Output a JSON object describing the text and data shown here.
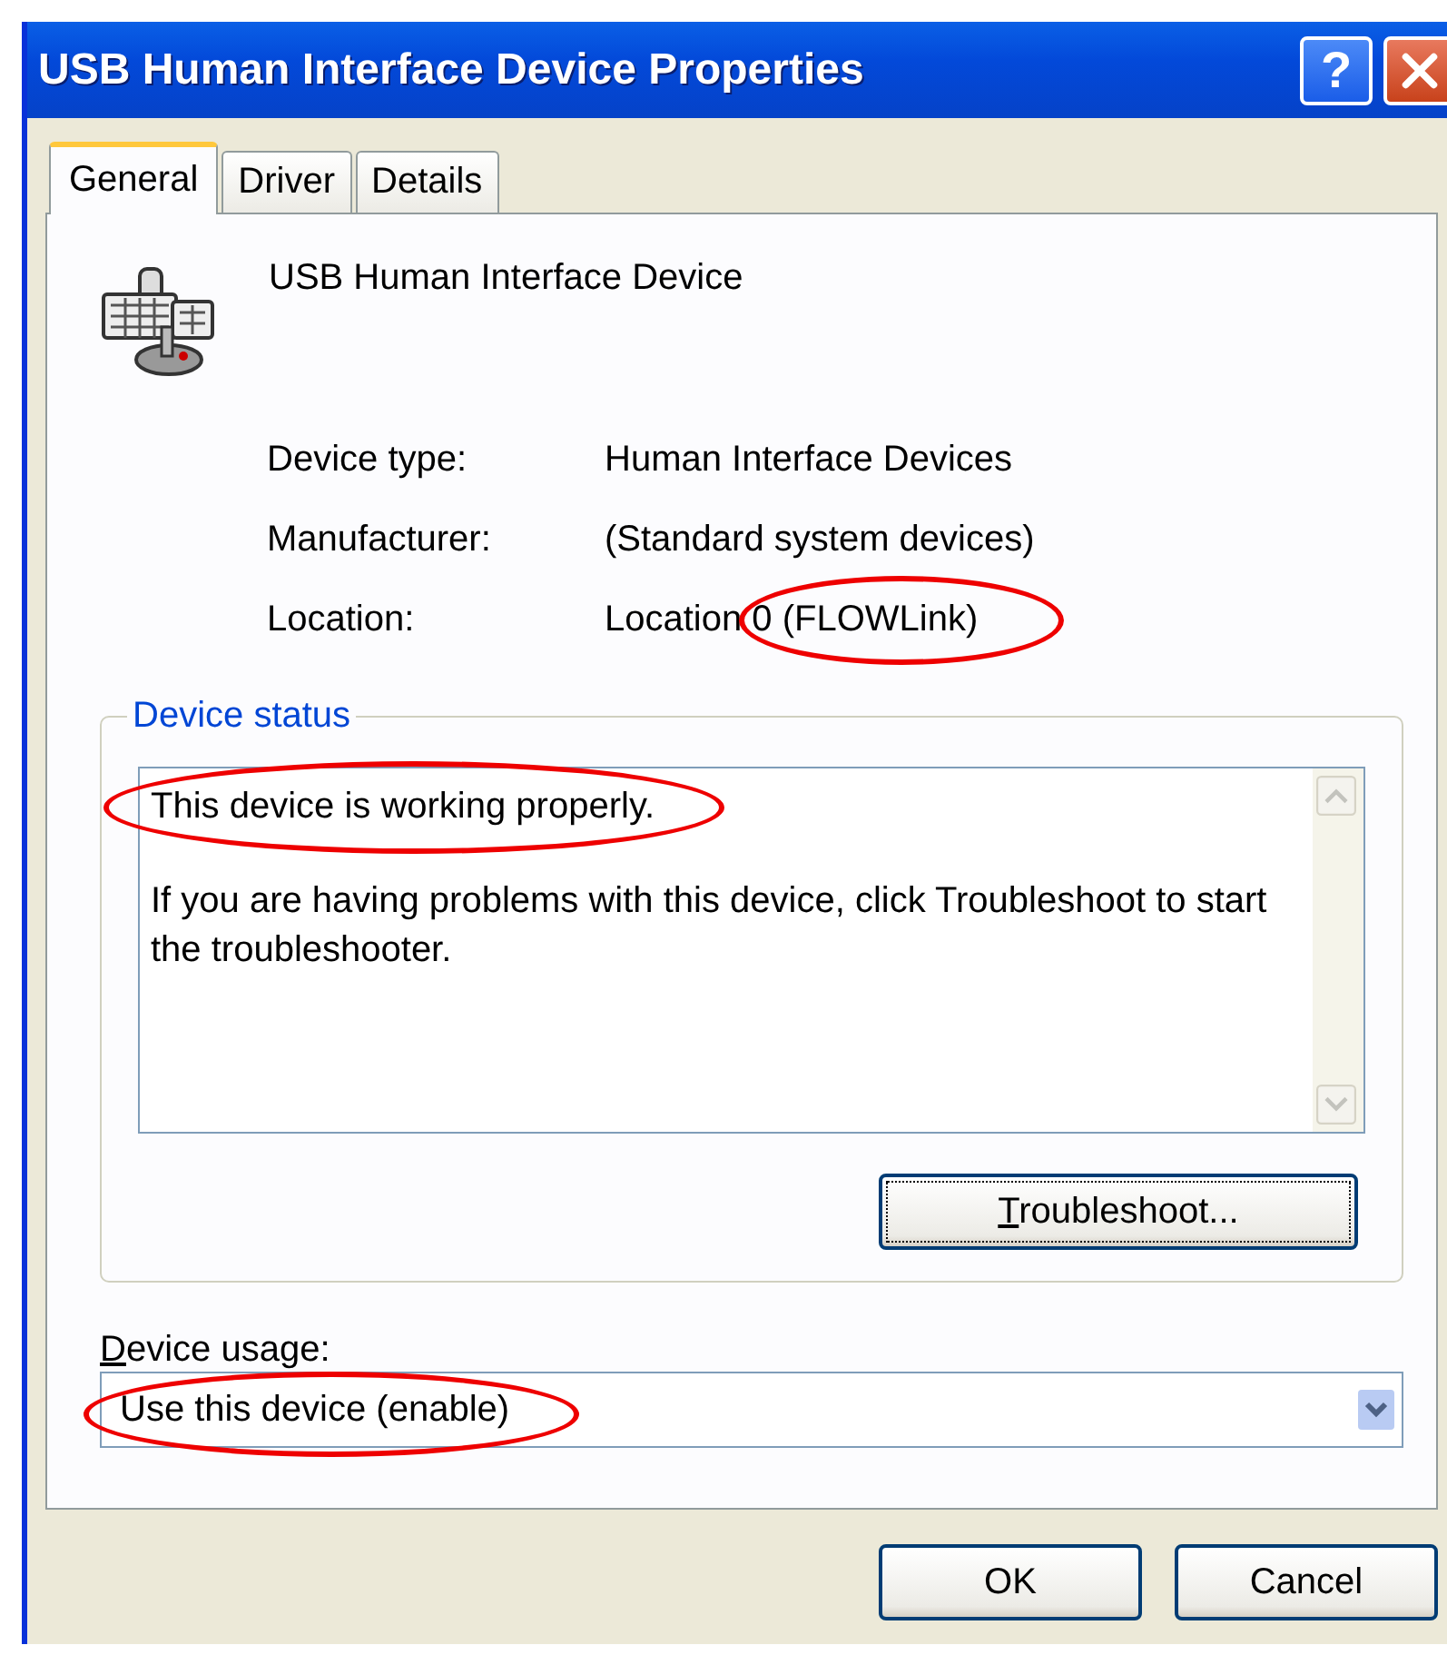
{
  "window": {
    "title": "USB Human Interface Device Properties",
    "help_button": "?"
  },
  "tabs": [
    {
      "label": "General",
      "selected": true
    },
    {
      "label": "Driver",
      "selected": false
    },
    {
      "label": "Details",
      "selected": false
    }
  ],
  "device": {
    "name": "USB Human Interface Device"
  },
  "properties": [
    {
      "label": "Device type:",
      "value": "Human Interface Devices",
      "circled": false
    },
    {
      "label": "Manufacturer:",
      "value": "(Standard system devices)",
      "circled": false
    },
    {
      "label": "Location:",
      "value": "Location 0 (FLOWLink)",
      "circled": true
    }
  ],
  "status": {
    "legend": "Device status",
    "lines": [
      {
        "text": "This device is working properly.",
        "circled": true
      },
      {
        "text": "If you are having problems with this device, click Troubleshoot to start the troubleshooter.",
        "circled": false
      }
    ],
    "button_key": "T",
    "button_rest": "roubleshoot..."
  },
  "usage": {
    "label_key": "D",
    "label_rest": "evice usage:",
    "value": "Use this device (enable)",
    "circled": true
  },
  "buttons": [
    {
      "label": "OK"
    },
    {
      "label": "Cancel"
    }
  ]
}
